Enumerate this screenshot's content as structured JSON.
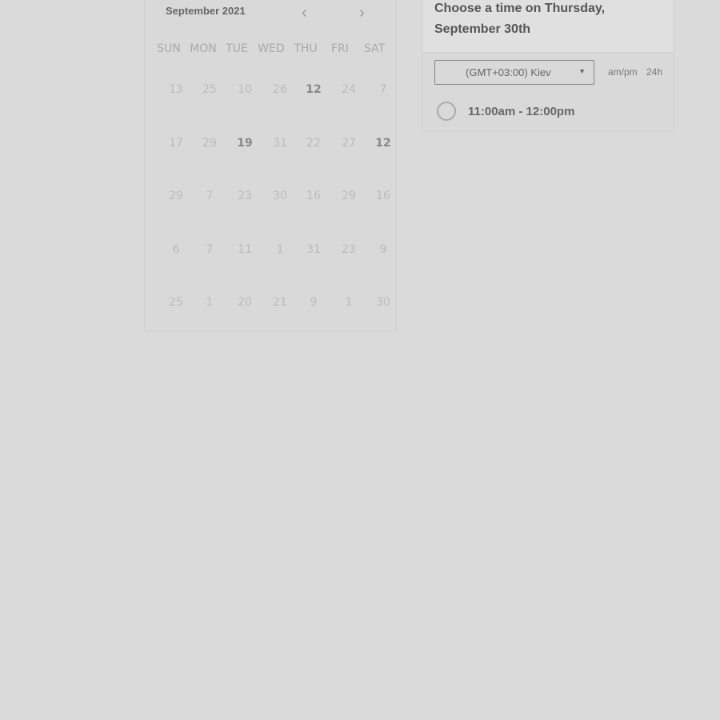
{
  "calendar": {
    "month_label": "September 2021",
    "weekdays": [
      "SUN",
      "MON",
      "TUE",
      "WED",
      "THU",
      "FRI",
      "SAT"
    ],
    "weeks": [
      [
        "13",
        "25",
        "10",
        "26",
        "12",
        "24",
        "7"
      ],
      [
        "17",
        "29",
        "19",
        "31",
        "22",
        "27",
        "12"
      ],
      [
        "29",
        "7",
        "23",
        "30",
        "16",
        "29",
        "16"
      ],
      [
        "6",
        "7",
        "11",
        "1",
        "31",
        "23",
        "9"
      ],
      [
        "25",
        "1",
        "20",
        "21",
        "9",
        "1",
        "30"
      ]
    ],
    "bold": [
      [
        0,
        4
      ],
      [
        1,
        2
      ],
      [
        1,
        6
      ]
    ]
  },
  "time_panel": {
    "title": "Choose a time on Thursday, September 30th",
    "timezone": "(GMT+03:00) Kiev",
    "format_ampm": "am/pm",
    "format_24h": "24h",
    "slots": [
      "11:00am - 12:00pm"
    ]
  }
}
